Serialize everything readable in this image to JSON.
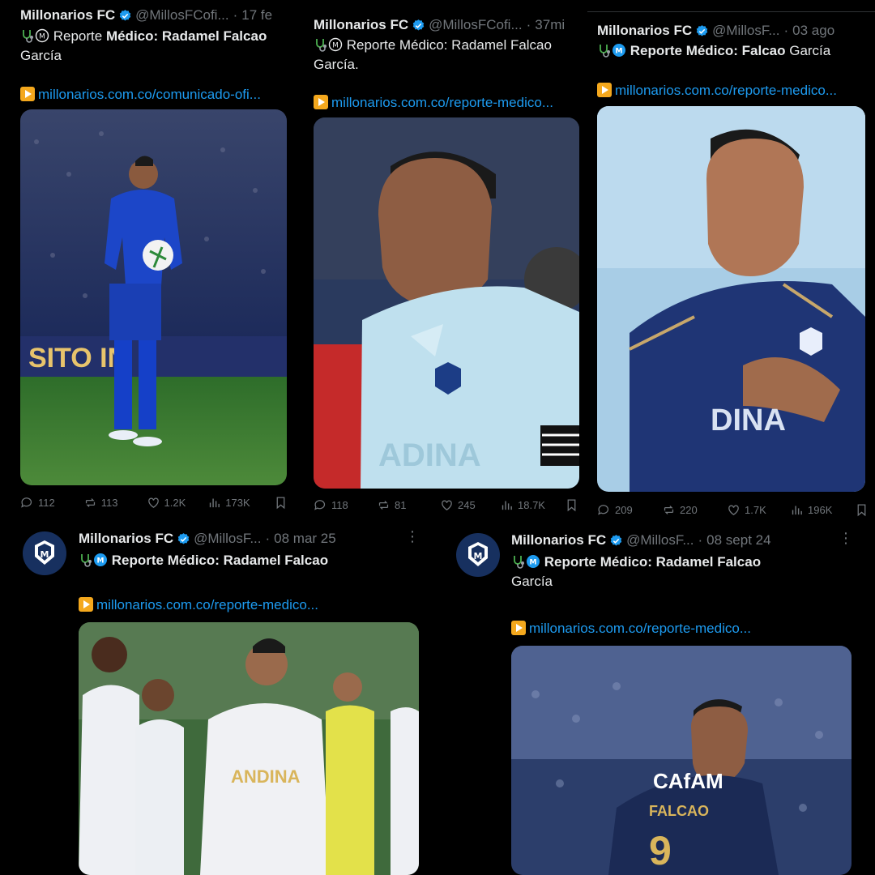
{
  "account": {
    "name": "Millonarios FC",
    "verified_icon": "verified-badge-icon"
  },
  "colors": {
    "link": "#1d9bf0",
    "muted": "#71767b",
    "text": "#e7e9ea",
    "club_blue": "#17305f"
  },
  "tweets": [
    {
      "handle": "@MillosFCofi...",
      "time": "17 fe",
      "text_pre": "Reporte ",
      "text_bold": "Médico: Radamel Falcao",
      "text_post": "García",
      "link": "millonarios.com.co/comunicado-ofi...",
      "stats": {
        "replies": "112",
        "reposts": "113",
        "likes": "1.2K",
        "views": "173K"
      }
    },
    {
      "handle": "@MillosFCofi...",
      "time": "37mi",
      "text_pre": "Reporte Médico: Radamel Falcao",
      "text_bold": "",
      "text_post": "García.",
      "link": "millonarios.com.co/reporte-medico...",
      "stats": {
        "replies": "118",
        "reposts": "81",
        "likes": "245",
        "views": "18.7K"
      }
    },
    {
      "handle": "@MillosF...",
      "time": "03 ago",
      "text_pre": "",
      "text_bold": "Reporte Médico: Falcao",
      "text_post": " García",
      "link": "millonarios.com.co/reporte-medico...",
      "stats": {
        "replies": "209",
        "reposts": "220",
        "likes": "1.7K",
        "views": "196K"
      }
    },
    {
      "handle": "@MillosF...",
      "time": "08 mar 25",
      "text_pre": "",
      "text_bold": "Reporte Médico: Radamel Falcao",
      "text_post": "",
      "link": "millonarios.com.co/reporte-medico..."
    },
    {
      "handle": "@MillosF...",
      "time": "08 sept 24",
      "text_pre": "",
      "text_bold": "Reporte Médico: Radamel Falcao",
      "text_post": "García",
      "link": "millonarios.com.co/reporte-medico..."
    }
  ]
}
